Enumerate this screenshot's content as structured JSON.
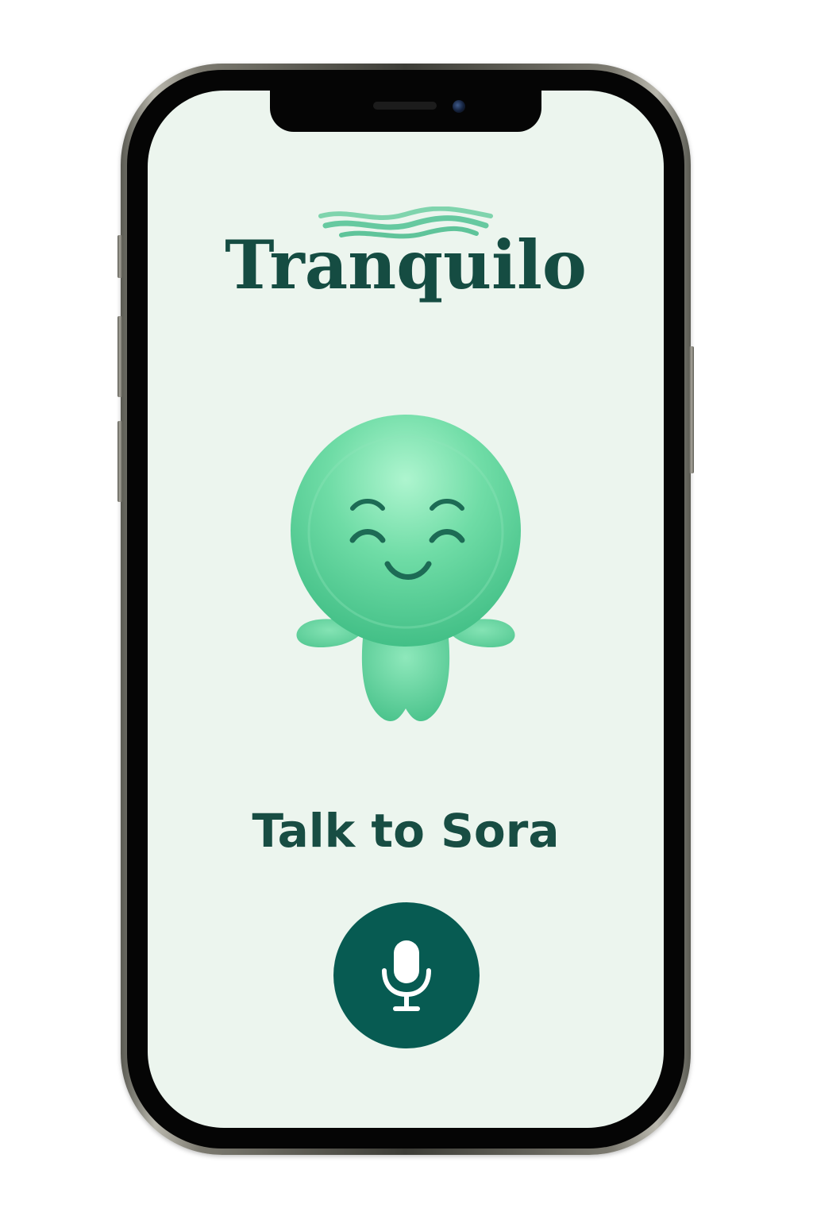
{
  "app": {
    "title": "Tranquilo"
  },
  "main": {
    "headline": "Talk to Sora",
    "mic_button": {
      "icon": "microphone-icon"
    },
    "mascot": {
      "icon": "smiling-mascot-illustration"
    }
  },
  "colors": {
    "screen_background": "#ecf5ee",
    "brand_dark_green": "#154c42",
    "mic_button_green": "#075b52",
    "mascot_mint": "#5dd39c",
    "wave_mint": "#66c9a0"
  }
}
